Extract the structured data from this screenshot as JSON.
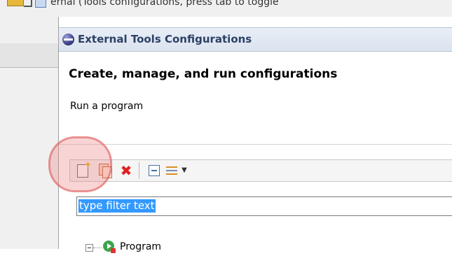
{
  "background_app": {
    "toolbar_text": "ernal  (Tools configurations, press tab to toggle"
  },
  "dialog": {
    "title": "External Tools Configurations",
    "heading": "Create, manage, and run configurations",
    "subtext": "Run a program",
    "toolbar": {
      "buttons": [
        {
          "name": "new-launch-configuration",
          "icon": "new-config-icon"
        },
        {
          "name": "duplicate",
          "icon": "duplicate-icon"
        },
        {
          "name": "delete",
          "icon": "delete-icon",
          "glyph": "✖"
        },
        {
          "name": "collapse-all",
          "icon": "collapse-all-icon"
        },
        {
          "name": "filter-configurations",
          "icon": "filter-icon"
        },
        {
          "name": "view-menu",
          "icon": "chevron-down-icon",
          "glyph": "▼"
        }
      ]
    },
    "filter": {
      "value": "type filter text"
    },
    "tree": {
      "items": [
        {
          "label": "Program",
          "expanded": true
        }
      ]
    }
  },
  "colors": {
    "highlight": "#e06060",
    "title_text": "#2c4066",
    "filter_selection": "#3399ff",
    "delete_red": "#e02020"
  }
}
